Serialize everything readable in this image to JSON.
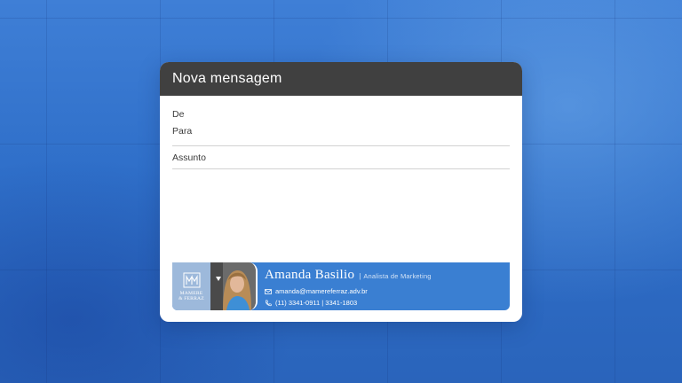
{
  "window": {
    "title": "Nova mensagem"
  },
  "compose": {
    "from_label": "De",
    "to_label": "Para",
    "subject_label": "Assunto"
  },
  "signature": {
    "logo": {
      "line1": "MAMERE",
      "line2": "& FERRAZ"
    },
    "name": "Amanda Basilio",
    "separator": "|",
    "role": "Analista de Marketing",
    "email": "amanda@mamereferraz.adv.br",
    "phone": "(11) 3341-0911 | 3341-1803",
    "icons": {
      "email": "envelope-icon",
      "phone": "phone-icon"
    },
    "colors": {
      "band": "#3a7fd2",
      "logo_bg": "#9db9db"
    }
  },
  "colors": {
    "titlebar": "#404040",
    "background": "#2f6fc9"
  }
}
